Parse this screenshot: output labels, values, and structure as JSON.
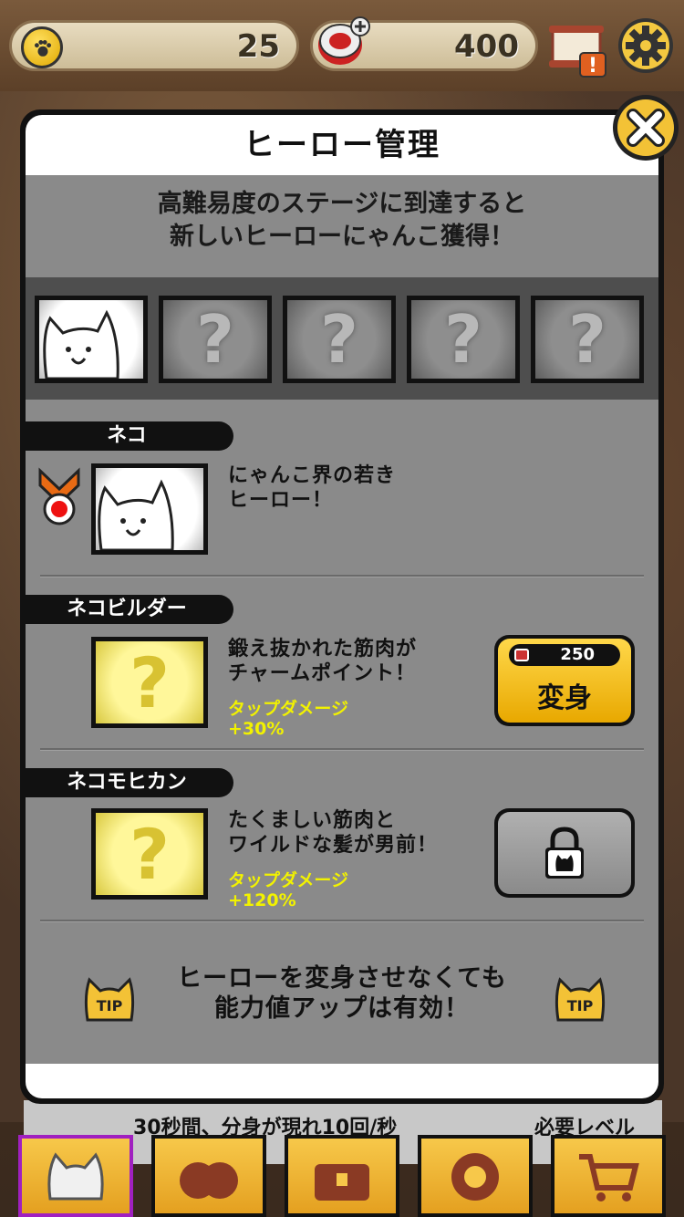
{
  "currency": {
    "xp_value": "25",
    "catfood_value": "400"
  },
  "modal": {
    "title": "ヒーロー管理",
    "intro_line1": "高難易度のステージに到達すると",
    "intro_line2": "新しいヒーローにゃんこ獲得！",
    "slot_unknown": "?"
  },
  "heroes": [
    {
      "name": "ネコ",
      "desc_line1": "にゃんこ界の若き",
      "desc_line2": "ヒーロー！"
    },
    {
      "name": "ネコビルダー",
      "desc_line1": "鍛え抜かれた筋肉が",
      "desc_line2": "チャームポイント！",
      "bonus_label": "タップダメージ",
      "bonus_value": "+30%",
      "cost": "250",
      "button_label": "変身",
      "portrait_unknown": "?"
    },
    {
      "name": "ネコモヒカン",
      "desc_line1": "たくましい筋肉と",
      "desc_line2": "ワイルドな髪が男前！",
      "bonus_label": "タップダメージ",
      "bonus_value": "+120%",
      "portrait_unknown": "?"
    }
  ],
  "tip": {
    "line1": "ヒーローを変身させなくても",
    "line2": "能力値アップは有効！",
    "badge": "TIP"
  },
  "bottom": {
    "info_line": "30秒間、分身が現れ10回/秒",
    "required_level": "必要レベル"
  },
  "colors": {
    "accent_yellow": "#ffd84a",
    "bonus_text": "#f2f200",
    "panel_gray": "#8a8a8a"
  }
}
